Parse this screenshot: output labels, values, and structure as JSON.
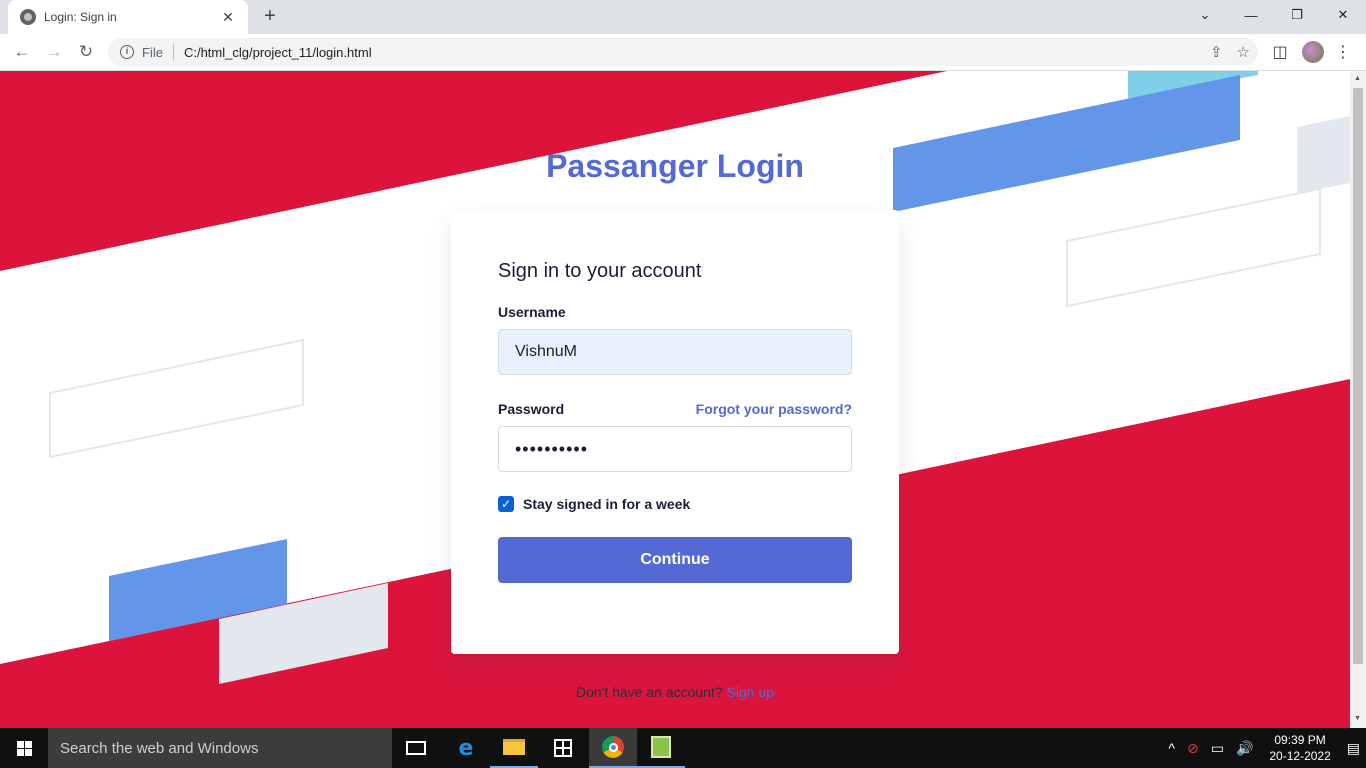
{
  "browser": {
    "tab_title": "Login: Sign in",
    "tab_close": "✕",
    "new_tab": "+",
    "window_controls": {
      "minimize": "—",
      "restore": "❐",
      "close": "✕",
      "tab_list": "⌄"
    },
    "nav": {
      "back": "←",
      "forward": "→",
      "reload": "↻"
    },
    "address": {
      "scheme_label": "File",
      "url": "C:/html_clg/project_11/login.html",
      "info_icon": "i"
    },
    "omnibox_icons": {
      "share": "⇪",
      "bookmark": "☆"
    },
    "toolbar_icons": {
      "side_panel": "◫",
      "menu": "⋮"
    }
  },
  "page": {
    "title": "Passanger Login",
    "card": {
      "heading": "Sign in to your account",
      "username_label": "Username",
      "username_value": "VishnuM",
      "password_label": "Password",
      "forgot_link": "Forgot your password?",
      "password_value": "••••••••••",
      "remember_label": "Stay signed in for a week",
      "remember_checked": true,
      "checkbox_mark": "✓",
      "continue_label": "Continue"
    },
    "signup": {
      "prompt": "Don't have an account?",
      "link": "Sign up"
    },
    "colors": {
      "accent": "#5469d4",
      "background_red": "#dc143c",
      "stripe_blue": "#6395e9",
      "stripe_light_blue": "#7fcfe8",
      "stripe_gray": "#e3e8ee"
    }
  },
  "taskbar": {
    "search_placeholder": "Search the web and Windows",
    "icons": [
      "windows-start-icon",
      "task-view-icon",
      "edge-icon",
      "file-explorer-icon",
      "store-icon",
      "chrome-icon",
      "notepad-icon"
    ],
    "edge_glyph": "e",
    "tray": {
      "chevron": "^",
      "network": "⊘",
      "battery": "▭",
      "volume": "🔊",
      "notifications": "▤"
    },
    "clock": {
      "time": "09:39 PM",
      "date": "20-12-2022"
    }
  }
}
